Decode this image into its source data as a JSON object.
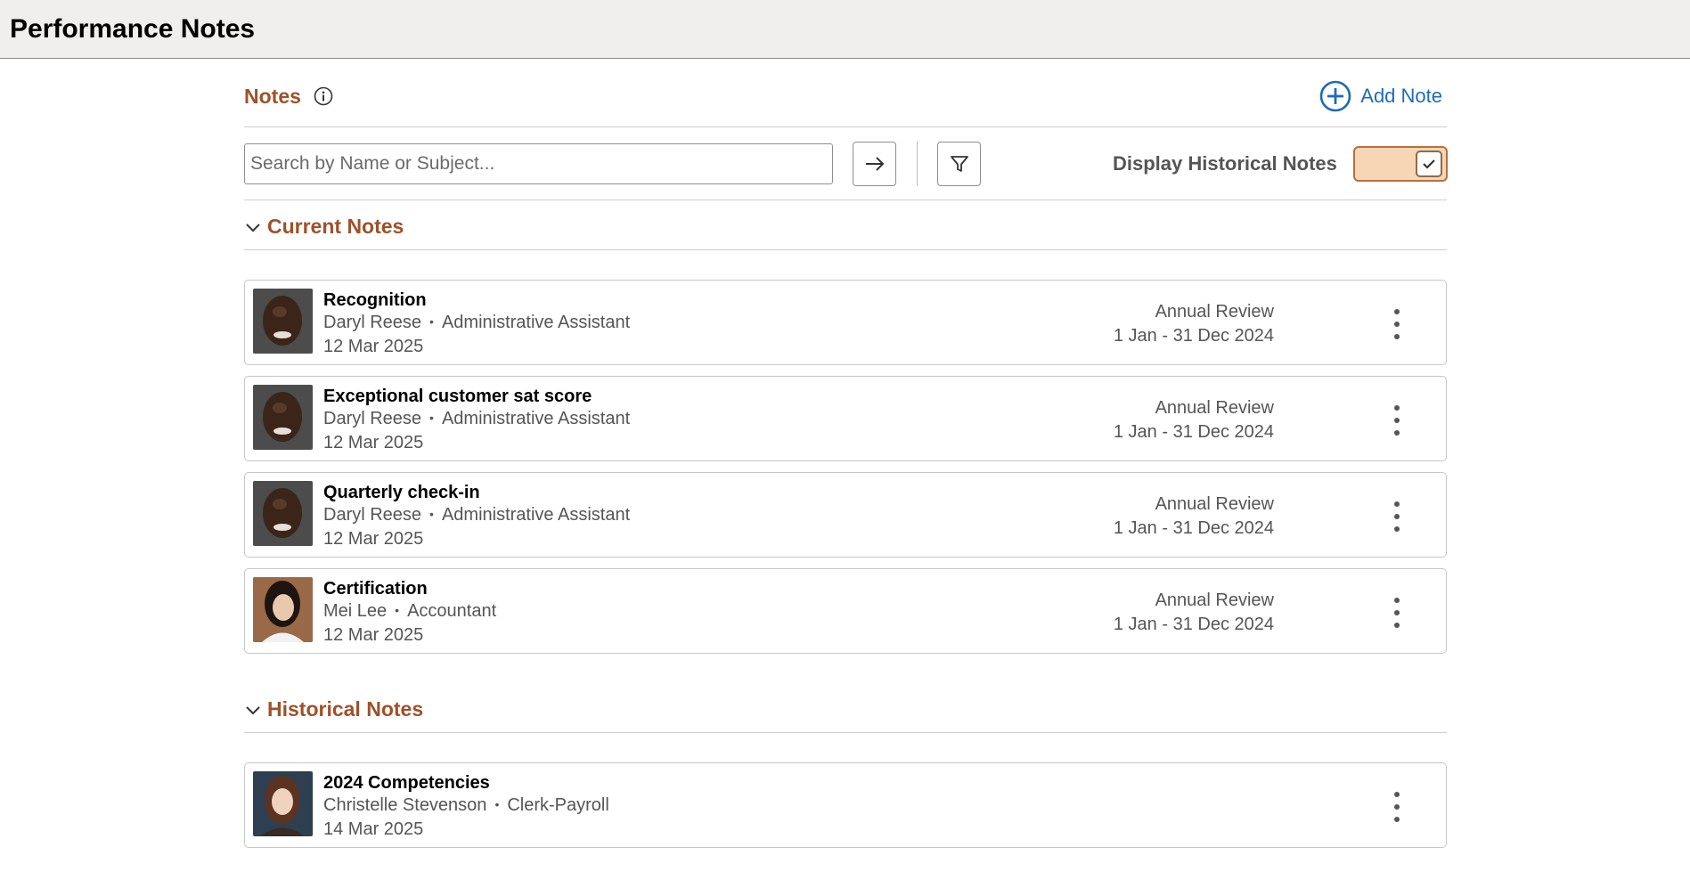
{
  "header": {
    "title": "Performance Notes"
  },
  "notes_header": {
    "title": "Notes",
    "add_label": "Add Note"
  },
  "search": {
    "placeholder": "Search by Name or Subject...",
    "value": ""
  },
  "historical_toggle": {
    "label": "Display Historical Notes",
    "checked": true
  },
  "sections": {
    "current": {
      "title": "Current Notes"
    },
    "historical": {
      "title": "Historical Notes"
    }
  },
  "current_notes": [
    {
      "title": "Recognition",
      "name": "Daryl Reese",
      "role": "Administrative Assistant",
      "date": "12 Mar 2025",
      "review": "Annual Review",
      "period": "1 Jan - 31 Dec 2024"
    },
    {
      "title": "Exceptional customer sat score",
      "name": "Daryl Reese",
      "role": "Administrative Assistant",
      "date": "12 Mar 2025",
      "review": "Annual Review",
      "period": "1 Jan - 31 Dec 2024"
    },
    {
      "title": "Quarterly check-in",
      "name": "Daryl Reese",
      "role": "Administrative Assistant",
      "date": "12 Mar 2025",
      "review": "Annual Review",
      "period": "1 Jan - 31 Dec 2024"
    },
    {
      "title": "Certification",
      "name": "Mei Lee",
      "role": "Accountant",
      "date": "12 Mar 2025",
      "review": "Annual Review",
      "period": "1 Jan - 31 Dec 2024"
    }
  ],
  "historical_notes": [
    {
      "title": "2024 Competencies",
      "name": "Christelle Stevenson",
      "role": "Clerk-Payroll",
      "date": "14 Mar 2025"
    }
  ],
  "colors": {
    "accent": "#9e5129",
    "link": "#1f6ab8",
    "toggle_bg": "#f7d6b5"
  }
}
